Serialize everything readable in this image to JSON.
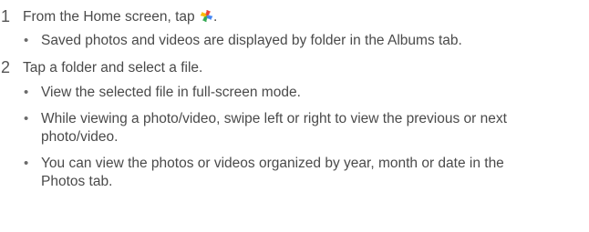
{
  "steps": [
    {
      "number": "1",
      "text_before_icon": "From the Home screen, tap",
      "icon": "google-photos-pinwheel-icon",
      "text_after_icon": ".",
      "bullets": [
        "Saved photos and videos are displayed by folder in the Albums tab."
      ]
    },
    {
      "number": "2",
      "text_before_icon": "Tap a folder and select a file.",
      "bullets": [
        "View the selected file in full-screen mode.",
        "While viewing a photo/video, swipe left or right to view the previous or next photo/video.",
        "You can view the photos or videos organized by year, month or date in the Photos tab."
      ]
    }
  ],
  "bullet_symbol": "•",
  "colors": {
    "text": "#4a4a4a",
    "icon_red": "#ea4335",
    "icon_yellow": "#fbbc05",
    "icon_green": "#34a853",
    "icon_blue": "#4285f4"
  }
}
